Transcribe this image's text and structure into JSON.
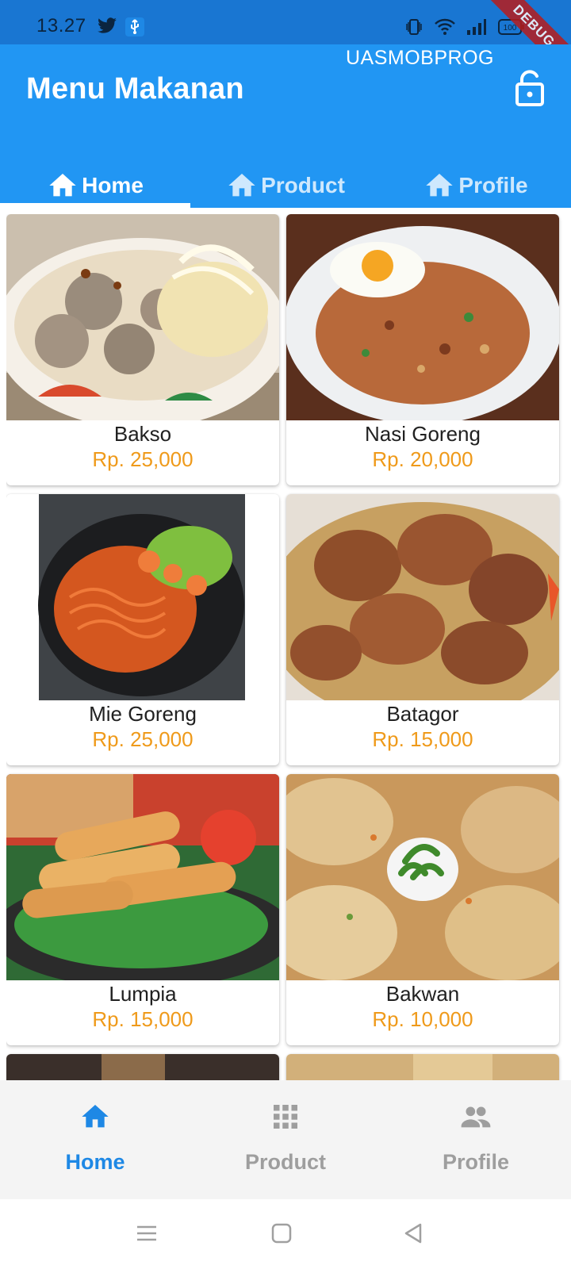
{
  "status_bar": {
    "time": "13.27",
    "battery": "100",
    "debug_label": "DEBUG"
  },
  "app_bar": {
    "subtitle": "UASMOBPROG",
    "title": "Menu Makanan"
  },
  "tabs": [
    {
      "label": "Home",
      "icon": "home-icon",
      "active": true
    },
    {
      "label": "Product",
      "icon": "home-icon",
      "active": false
    },
    {
      "label": "Profile",
      "icon": "home-icon",
      "active": false
    }
  ],
  "products": [
    {
      "name": "Bakso",
      "price": "Rp. 25,000"
    },
    {
      "name": "Nasi Goreng",
      "price": "Rp. 20,000"
    },
    {
      "name": "Mie Goreng",
      "price": "Rp. 25,000"
    },
    {
      "name": "Batagor",
      "price": "Rp. 15,000"
    },
    {
      "name": "Lumpia",
      "price": "Rp. 15,000"
    },
    {
      "name": "Bakwan",
      "price": "Rp. 10,000"
    }
  ],
  "bottom_nav": [
    {
      "label": "Home",
      "icon": "home-icon",
      "active": true
    },
    {
      "label": "Product",
      "icon": "apps-grid-icon",
      "active": false
    },
    {
      "label": "Profile",
      "icon": "people-icon",
      "active": false
    }
  ],
  "colors": {
    "app_bar": "#2196f3",
    "status_bar": "#1976d2",
    "price": "#ef9a1a",
    "nav_active": "#1e88e5",
    "nav_inactive": "#9e9e9e"
  }
}
